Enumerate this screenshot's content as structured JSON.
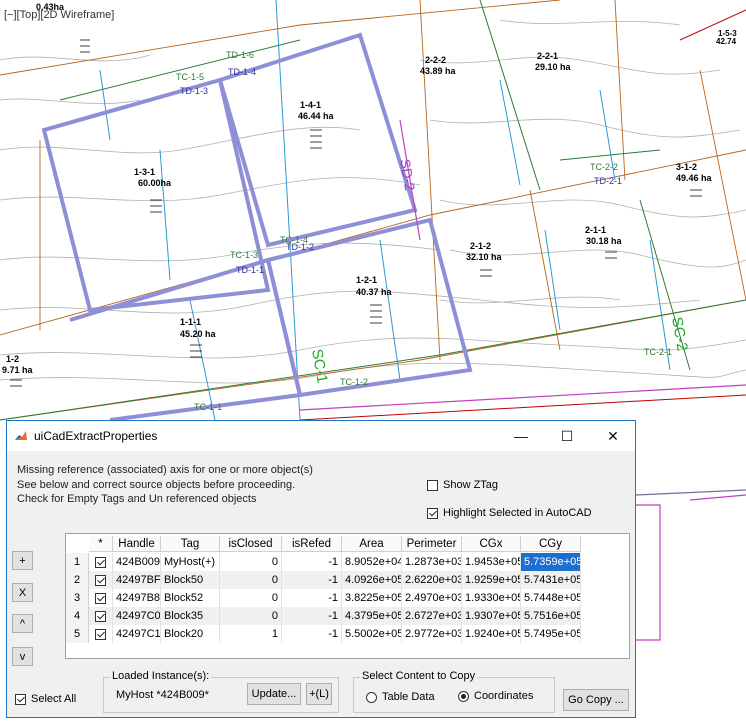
{
  "viewport": {
    "label": "[−][Top][2D Wireframe]"
  },
  "cad_labels": [
    {
      "text": "2-2-2\n43.89 ha"
    },
    {
      "text": "2-2-1\n29.10 ha"
    },
    {
      "text": "1-4-1\n46.44 ha"
    },
    {
      "text": "1-3-1\n60.00ha"
    },
    {
      "text": "2-1-2\n32.10 ha"
    },
    {
      "text": "2-1-1\n30.18 ha"
    },
    {
      "text": "3-1-2\n49.46 ha"
    },
    {
      "text": "1-1-1\n45.20 ha"
    },
    {
      "text": "1-2-1\n40.37 ha"
    },
    {
      "text": "1-2\n9.71 ha"
    },
    {
      "text": "TD-1-5"
    },
    {
      "text": "TD-1-6"
    },
    {
      "text": "TD-1-3"
    },
    {
      "text": "TD-1-4"
    },
    {
      "text": "TD-1-3"
    },
    {
      "text": "TD-1-4"
    },
    {
      "text": "TD-1-1"
    },
    {
      "text": "TD-1-2"
    },
    {
      "text": "TC-2-2"
    },
    {
      "text": "TD-2-1"
    },
    {
      "text": "TC-1-1"
    },
    {
      "text": "TC-1-2"
    },
    {
      "text": "TC-2-1"
    },
    {
      "text": "SD-2"
    },
    {
      "text": "SC-1"
    },
    {
      "text": "SC-2"
    },
    {
      "text": "1-5-3\n42.74"
    },
    {
      "text": "0.43ha"
    }
  ],
  "window": {
    "title": "uiCadExtractProperties",
    "controls": {
      "minimize": "—",
      "maximize": "☐",
      "close": "✕"
    },
    "message_lines": [
      "Missing reference (associated) axis for one or more object(s)",
      "See below and correct source objects before proceeding.",
      "Check for Empty Tags and Un referenced objects"
    ],
    "show_ztag": {
      "label": "Show ZTag",
      "checked": false
    },
    "highlight_selected": {
      "label": "Highlight Selected in AutoCAD",
      "checked": true
    },
    "side_buttons": [
      "+",
      "X",
      "^",
      "v"
    ],
    "table": {
      "columns": [
        "*",
        "Handle",
        "Tag",
        "isClosed",
        "isRefed",
        "Area",
        "Perimeter",
        "CGx",
        "CGy"
      ],
      "rows": [
        {
          "n": "1",
          "checked": true,
          "handle": "424B009",
          "tag": "MyHost(+)",
          "isClosed": "0",
          "isRefed": "-1",
          "area": "8.9052e+04",
          "perimeter": "1.2873e+03",
          "cgx": "1.9453e+05",
          "cgy": "5.7359e+05"
        },
        {
          "n": "2",
          "checked": true,
          "handle": "42497BF",
          "tag": "Block50",
          "isClosed": "0",
          "isRefed": "-1",
          "area": "4.0926e+05",
          "perimeter": "2.6220e+03",
          "cgx": "1.9259e+05",
          "cgy": "5.7431e+05"
        },
        {
          "n": "3",
          "checked": true,
          "handle": "42497B8",
          "tag": "Block52",
          "isClosed": "0",
          "isRefed": "-1",
          "area": "3.8225e+05",
          "perimeter": "2.4970e+03",
          "cgx": "1.9330e+05",
          "cgy": "5.7448e+05"
        },
        {
          "n": "4",
          "checked": true,
          "handle": "42497C0",
          "tag": "Block35",
          "isClosed": "0",
          "isRefed": "-1",
          "area": "4.3795e+05",
          "perimeter": "2.6727e+03",
          "cgx": "1.9307e+05",
          "cgy": "5.7516e+05"
        },
        {
          "n": "5",
          "checked": true,
          "handle": "42497C1",
          "tag": "Block20",
          "isClosed": "1",
          "isRefed": "-1",
          "area": "5.5002e+05",
          "perimeter": "2.9772e+03",
          "cgx": "1.9240e+05",
          "cgy": "5.7495e+05"
        }
      ]
    },
    "select_all": {
      "label": "Select All",
      "checked": true
    },
    "loaded_instance": {
      "title": "Loaded Instance(s):",
      "value": "MyHost *424B009*",
      "update_label": "Update...",
      "plusL_label": "+(L)"
    },
    "copy_group": {
      "title": "Select Content to Copy",
      "table_data": "Table Data",
      "coordinates": "Coordinates",
      "selected": "coordinates"
    },
    "go_copy_label": "Go Copy ..."
  }
}
